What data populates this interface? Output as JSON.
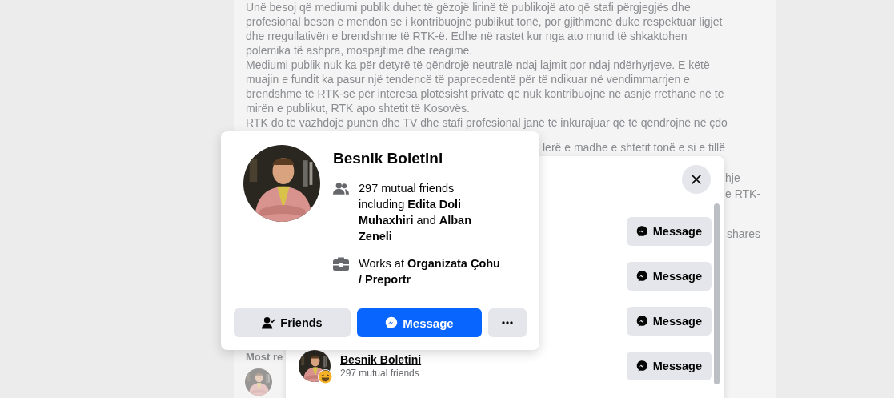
{
  "post": {
    "lines": [
      "Unë besoj që mediumi publik duhet të gëzojë lirinë të publikojë ato që stafi përgjegjës dhe",
      "profesional beson e mendon se i kontribuojnë publikut tonë, por gjithmonë duke respektuar ligjet",
      "dhe rregullativën e brendshme të RTK-ë. Edhe në rastet kur nga ato mund të shkaktohen",
      "polemika të ashpra, mospajtime dhe reagime.",
      "Mediumi publik nuk ka për detyrë të qëndrojë neutralë ndaj lajmit por ndaj ndërhyrjeve. E këtë",
      "muajin e fundit ka pasur një tendencë të paprecedentë për të ndikuar në vendimmarrjen e",
      "brendshme të RTK-së për interesa plotësisht private që nuk kontribuojnë në asnjë rrethanë në të",
      "mirën e publikut, RTK apo shtetit të Kosovës.",
      "RTK do të vazhdojë punën dhe TV dhe stafi profesional janë të inkurajuar që të qëndrojnë në çdo"
    ],
    "covered_line_end": "lerë e madhe e shtetit tonë e si e tillë",
    "right_edge_lines": [
      "hje",
      "e RTK-"
    ],
    "shares": "shares",
    "section_heading": "Most re"
  },
  "reactions_dialog": {
    "rows": [
      {
        "button": "Message"
      },
      {
        "button": "Message"
      },
      {
        "button": "Message"
      },
      {
        "name": "Besnik Boletini",
        "subtitle": "297 mutual friends",
        "button": "Message"
      }
    ]
  },
  "profile_card": {
    "name": "Besnik Boletini",
    "details": [
      {
        "kind": "mutual",
        "text": "297 mutual friends including **Edita Doli Muhaxhiri** and **Alban Zeneli**"
      },
      {
        "kind": "work",
        "text": "Works at **Organizata Çohu / Preportr**"
      }
    ],
    "buttons": [
      {
        "kind": "friends",
        "label": "Friends"
      },
      {
        "kind": "message",
        "label": "Message"
      },
      {
        "kind": "more"
      }
    ]
  }
}
